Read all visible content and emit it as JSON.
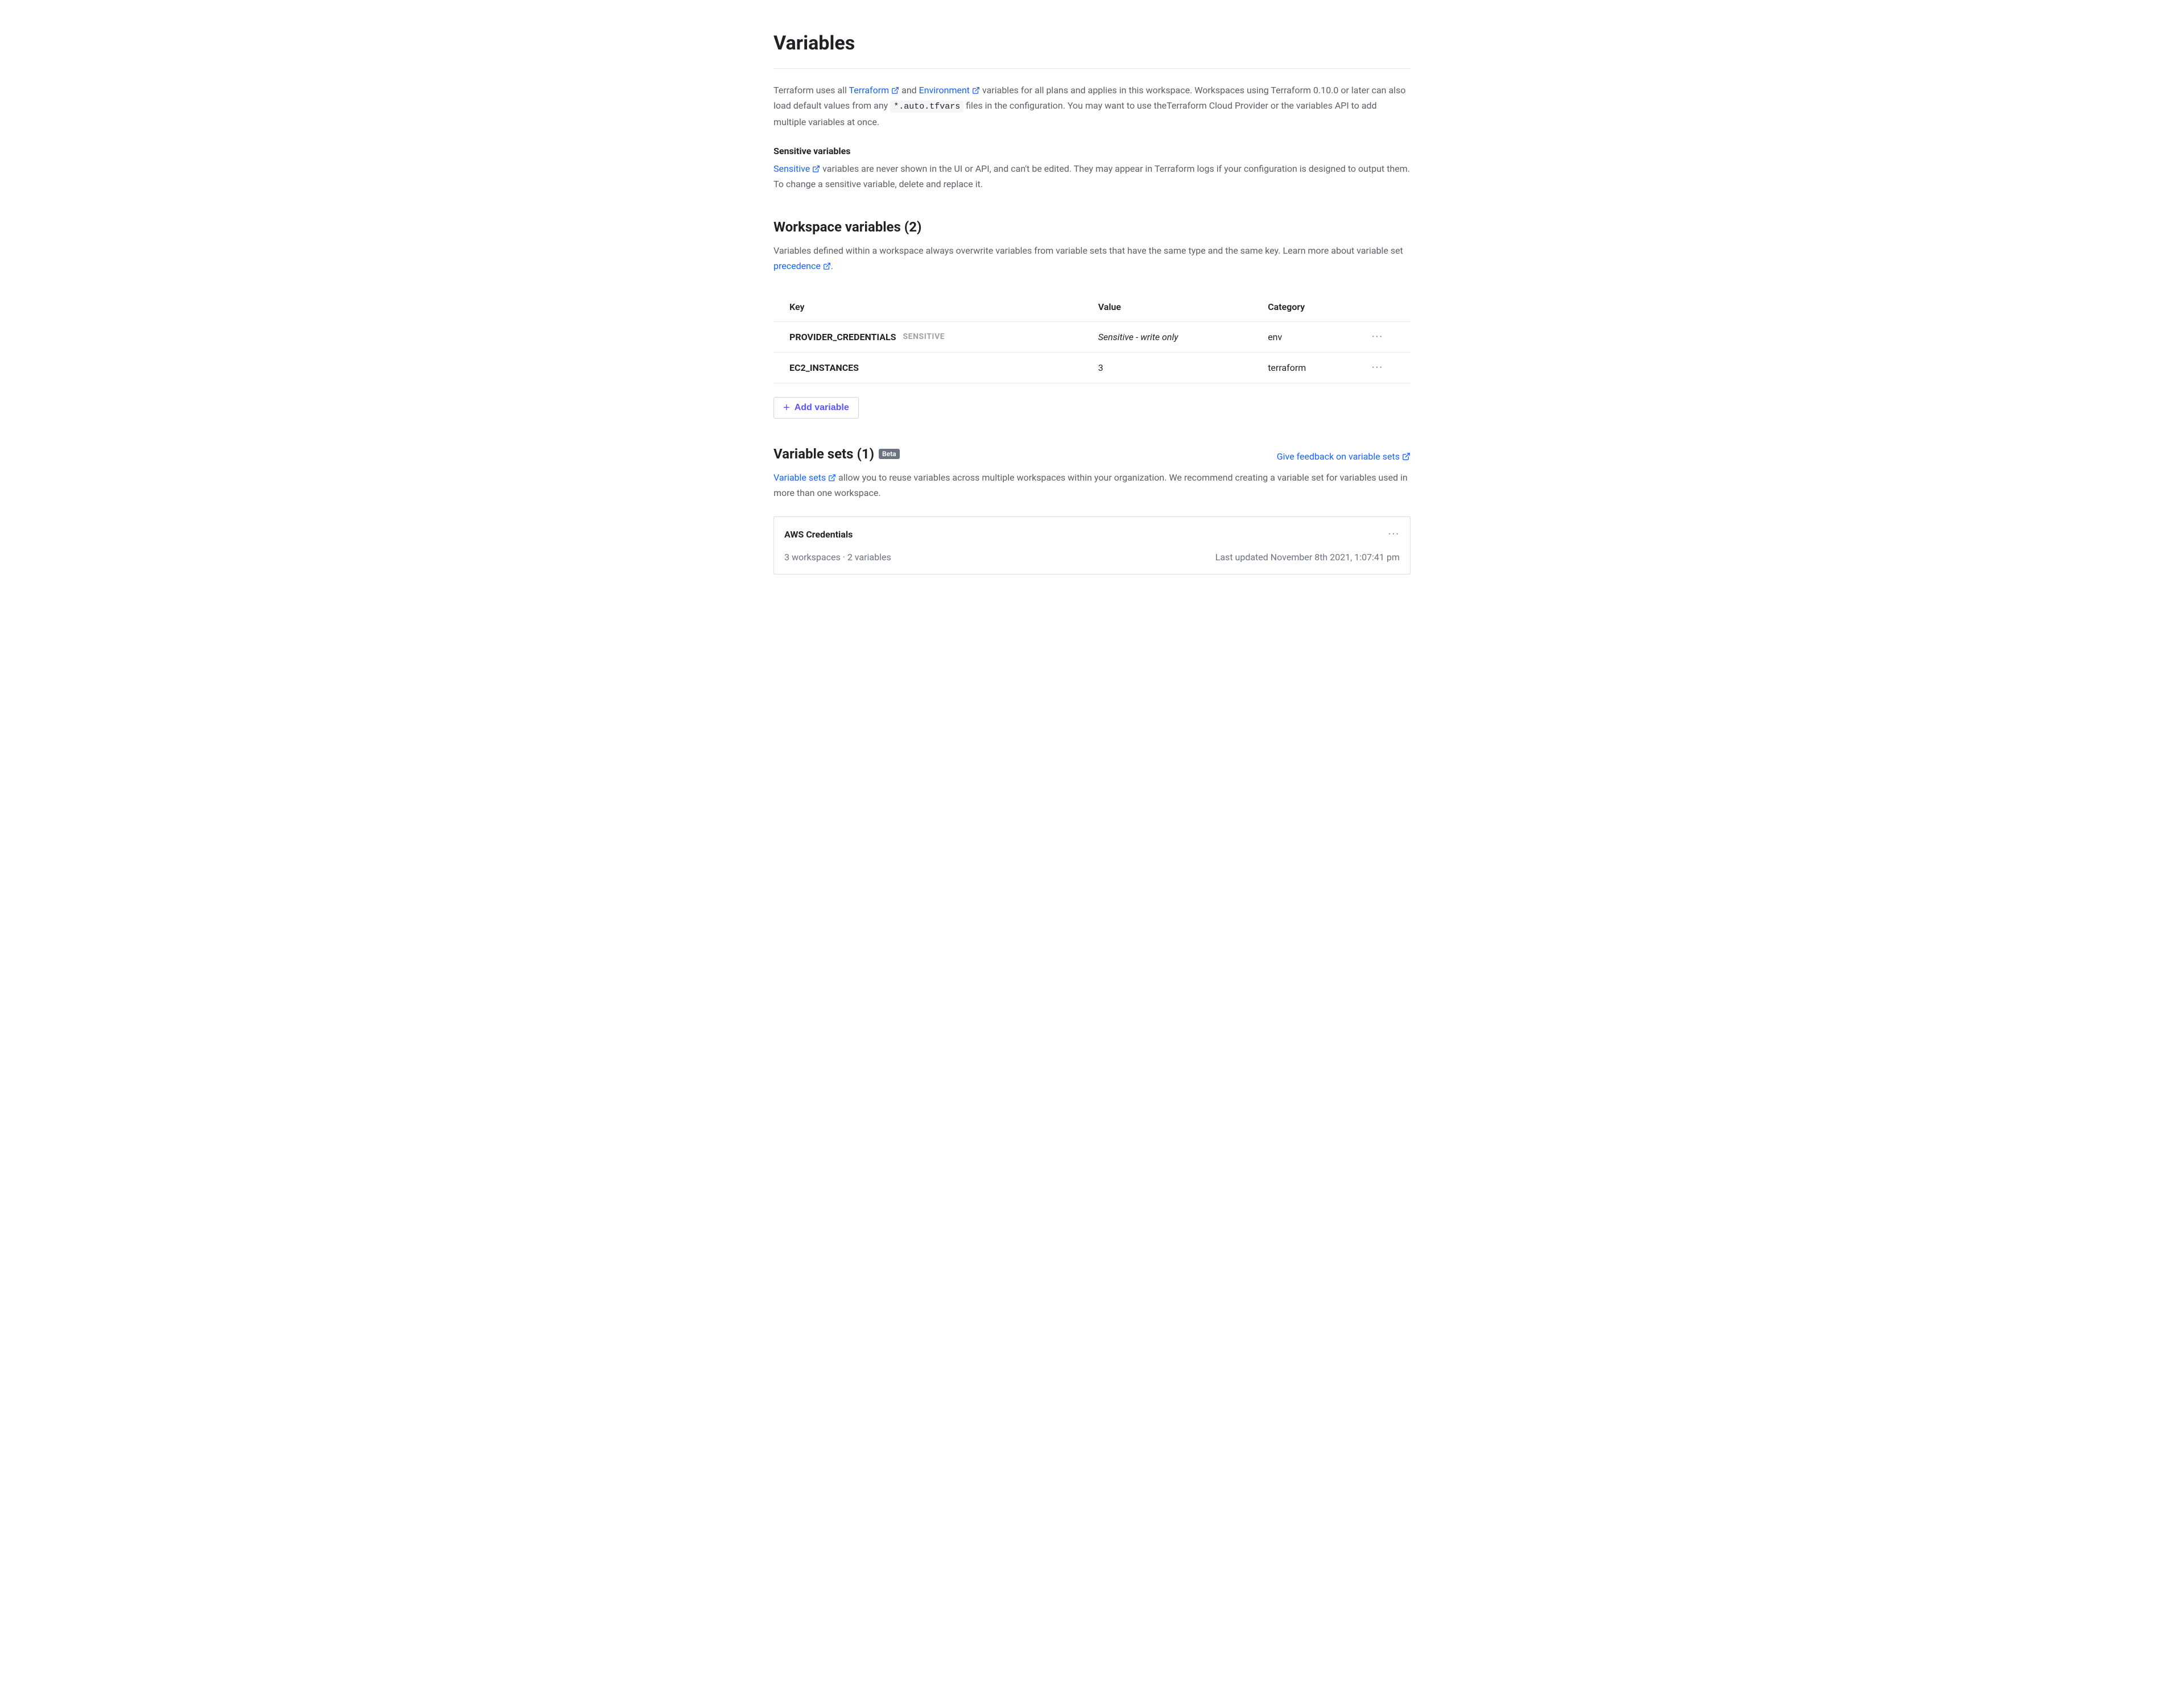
{
  "page": {
    "title": "Variables"
  },
  "intro": {
    "pre_link1": "Terraform uses all ",
    "link1": "Terraform",
    "between_links": " and ",
    "link2": "Environment",
    "post_link2_pre_code": " variables for all plans and applies in this workspace. Workspaces using Terraform 0.10.0 or later can also load default values from any ",
    "code": "*.auto.tfvars",
    "post_code": " files in the configuration. You may want to use theTerraform Cloud Provider or the variables API to add multiple variables at once."
  },
  "sensitive": {
    "heading": "Sensitive variables",
    "link": "Sensitive",
    "rest": " variables are never shown in the UI or API, and can't be edited. They may appear in Terraform logs if your configuration is designed to output them. To change a sensitive variable, delete and replace it."
  },
  "workspace_vars": {
    "heading": "Workspace variables (2)",
    "desc_pre": "Variables defined within a workspace always overwrite variables from variable sets that have the same type and the same key. Learn more about variable set ",
    "desc_link": "precedence",
    "desc_post": ".",
    "columns": {
      "key": "Key",
      "value": "Value",
      "category": "Category"
    },
    "rows": [
      {
        "key": "PROVIDER_CREDENTIALS",
        "sensitive": true,
        "sensitive_tag": "SENSITIVE",
        "value": "Sensitive - write only",
        "category": "env"
      },
      {
        "key": "EC2_INSTANCES",
        "sensitive": false,
        "value": "3",
        "category": "terraform"
      }
    ],
    "add_button": "Add variable"
  },
  "variable_sets": {
    "heading": "Variable sets (1)",
    "beta": "Beta",
    "feedback": "Give feedback on variable sets",
    "desc_link": "Variable sets",
    "desc_rest": " allow you to reuse variables across multiple workspaces within your organization. We recommend creating a variable set for variables used in more than one workspace.",
    "card": {
      "name": "AWS Credentials",
      "meta_left": "3 workspaces  ·  2 variables",
      "meta_right": "Last updated November 8th 2021, 1:07:41 pm"
    }
  }
}
